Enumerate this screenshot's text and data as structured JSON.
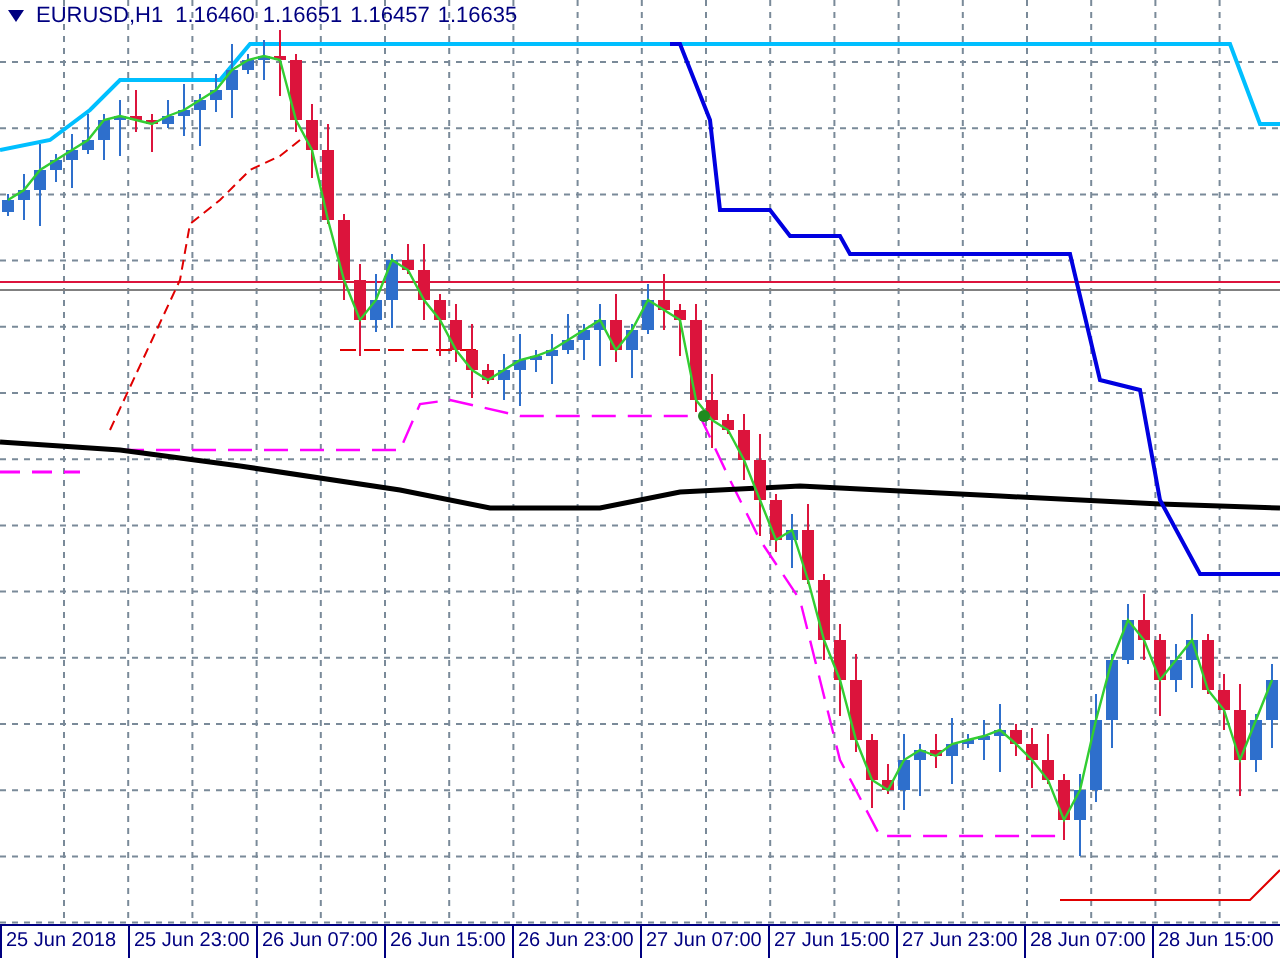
{
  "chart_header": {
    "symbol": "EURUSD,H1",
    "prices": [
      "1.16460",
      "1.16651",
      "1.16457",
      "1.16635"
    ]
  },
  "time_axis": {
    "labels": [
      "25 Jun 2018",
      "25 Jun 23:00",
      "26 Jun 07:00",
      "26 Jun 15:00",
      "26 Jun 23:00",
      "27 Jun 07:00",
      "27 Jun 15:00",
      "27 Jun 23:00",
      "28 Jun 07:00",
      "28 Jun 15:00"
    ]
  }
}
